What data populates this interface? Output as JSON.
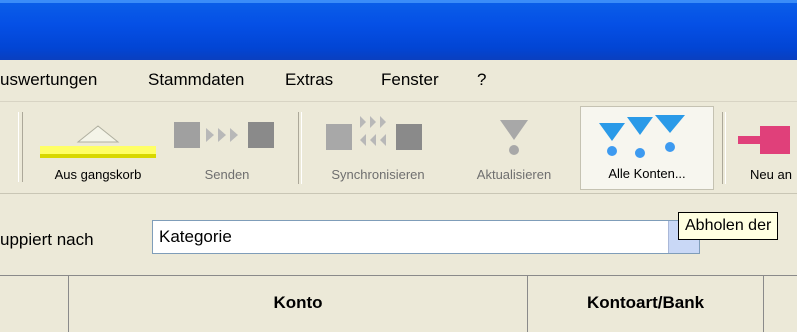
{
  "menu": [
    "uswertungen",
    "Stammdaten",
    "Extras",
    "Fenster",
    "?"
  ],
  "toolbar": {
    "buttons": [
      {
        "label": "Aus gangskorb",
        "icon": "outbox-icon",
        "enabled": true
      },
      {
        "label": "Senden",
        "icon": "send-icon",
        "enabled": false
      },
      {
        "label": "Synchronisieren",
        "icon": "sync-icon",
        "enabled": false
      },
      {
        "label": "Aktualisieren",
        "icon": "refresh-icon",
        "enabled": false
      },
      {
        "label": "Alle Konten...",
        "icon": "all-accounts-icon",
        "enabled": true
      },
      {
        "label": "Neu an",
        "icon": "new-icon",
        "enabled": true
      }
    ]
  },
  "grouping": {
    "label": "uppiert nach",
    "value": "Kategorie"
  },
  "tooltip": "Abholen der",
  "grid": {
    "columns": [
      "Konto",
      "Kontoart/Bank"
    ]
  }
}
